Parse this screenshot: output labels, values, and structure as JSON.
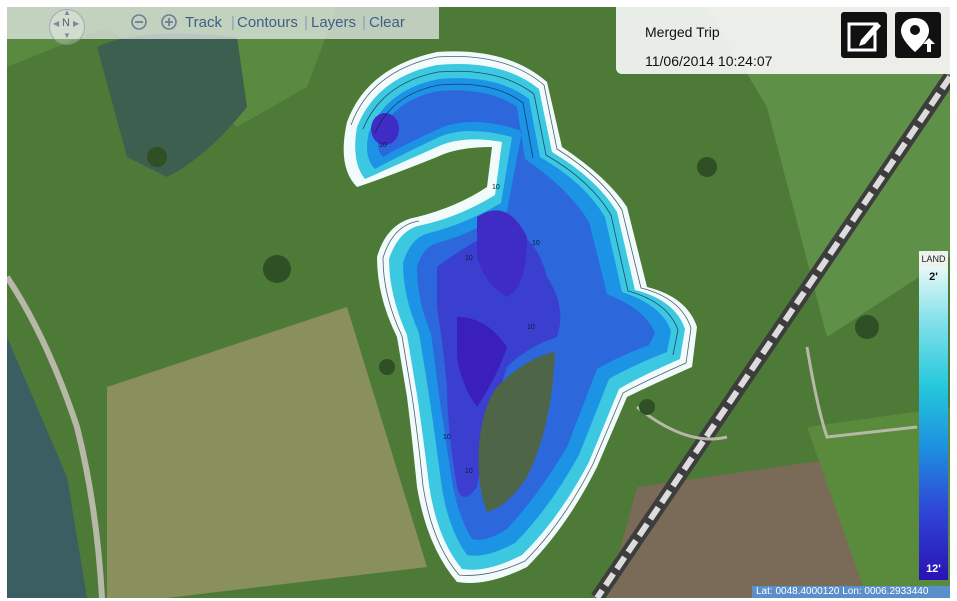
{
  "toolbar": {
    "compass_label": "N",
    "items": [
      {
        "label": "Track"
      },
      {
        "label": "Contours"
      },
      {
        "label": "Layers"
      },
      {
        "label": "Clear"
      }
    ],
    "separator": "|"
  },
  "info_panel": {
    "title": "Merged Trip",
    "datetime": "11/06/2014 10:24:07",
    "edit_icon": "edit-icon",
    "location_icon": "location-upload-icon"
  },
  "legend": {
    "header": "LAND",
    "min_label": "2'",
    "max_label": "12'",
    "colors": [
      "#e6f8f8",
      "#25c8dc",
      "#1e8fe0",
      "#2f45d8",
      "#2a12b5"
    ]
  },
  "contour_labels": [
    "10",
    "10",
    "10",
    "10",
    "10",
    "10",
    "10"
  ],
  "coordinates": "Lat: 0048.4000120 Lon: 0006.2933440"
}
